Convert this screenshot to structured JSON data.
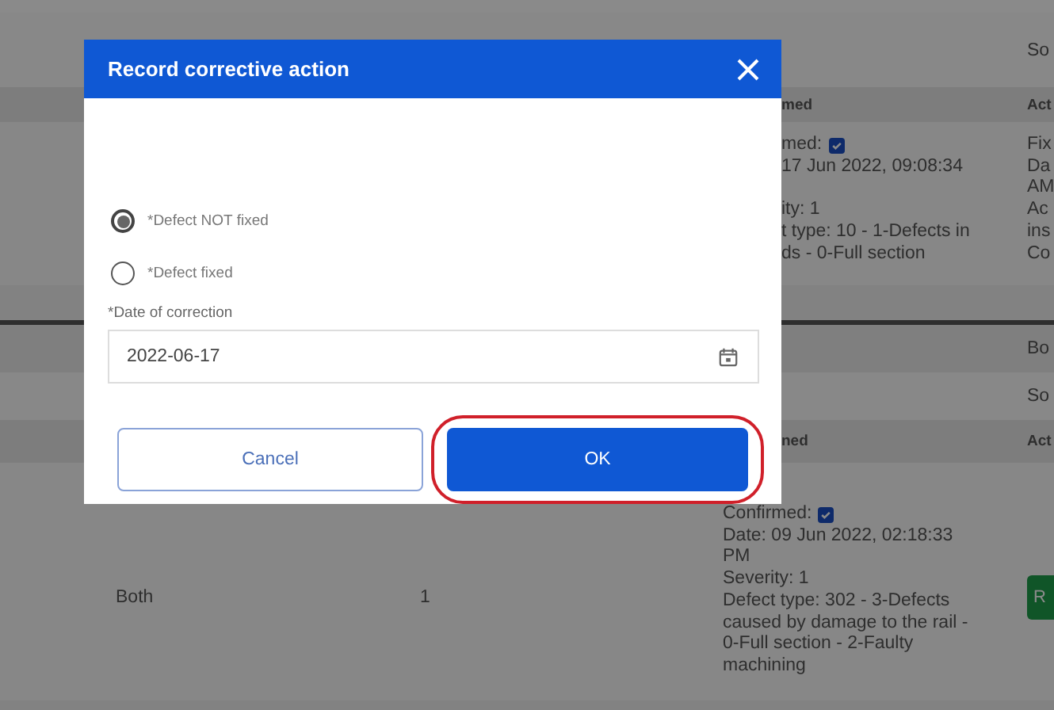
{
  "background": {
    "sections": [
      {
        "top_rows": [
          "So"
        ],
        "header": [
          "med",
          "Act"
        ],
        "row": {
          "confirmed_label": "med:",
          "confirmed": true,
          "lines": [
            "17 Jun 2022, 09:08:34",
            "ity: 1",
            "t type: 10 - 1-Defects in",
            "ds - 0-Full section"
          ],
          "column_4": [
            "Fix",
            "Da",
            "AM",
            "Ac",
            "ins",
            "Co"
          ]
        }
      },
      {
        "top_rows": [
          "Bo",
          "So"
        ],
        "header": [
          "ned",
          "Act"
        ],
        "row": {
          "column_1": "Both",
          "column_2": "1",
          "confirmed_label": "Confirmed:",
          "confirmed": true,
          "lines": [
            "Date: 09 Jun 2022, 02:18:33",
            "PM",
            "Severity: 1",
            "Defect type: 302 - 3-Defects",
            "caused by damage to the rail -",
            "0-Full section - 2-Faulty",
            "machining"
          ],
          "action": "R"
        }
      }
    ]
  },
  "modal": {
    "title": "Record corrective action",
    "options": [
      {
        "label": "*Defect NOT fixed",
        "selected": true
      },
      {
        "label": "*Defect fixed",
        "selected": false
      }
    ],
    "date_field": {
      "label": "*Date of correction",
      "value": "2022-06-17"
    },
    "buttons": [
      {
        "label": "Cancel",
        "kind": "secondary",
        "highlighted": false
      },
      {
        "label": "OK",
        "kind": "primary",
        "highlighted": true
      }
    ]
  }
}
